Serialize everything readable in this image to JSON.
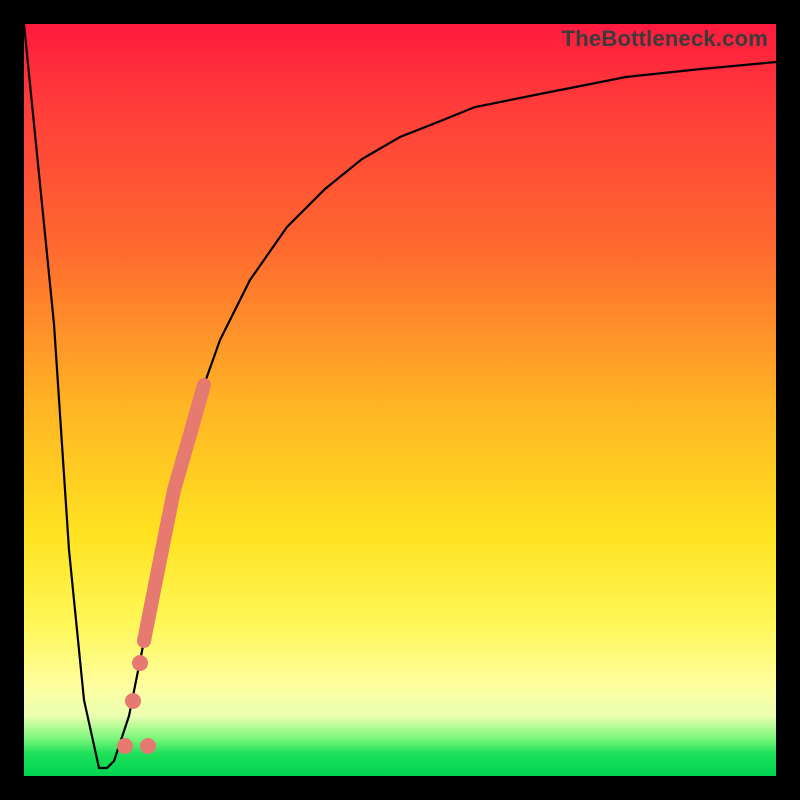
{
  "watermark": "TheBottleneck.com",
  "colors": {
    "gradient_top": "#ff1a3e",
    "gradient_mid": "#ffe321",
    "gradient_bottom": "#00d351",
    "curve": "#000000",
    "marker": "#e67a70",
    "frame": "#000000"
  },
  "chart_data": {
    "type": "line",
    "title": "",
    "xlabel": "",
    "ylabel": "",
    "xlim": [
      0,
      100
    ],
    "ylim": [
      0,
      100
    ],
    "grid": false,
    "legend": false,
    "series": [
      {
        "name": "bottleneck-curve",
        "x": [
          0,
          4,
          6,
          8,
          10,
          11,
          12,
          14,
          16,
          18,
          20,
          22,
          24,
          26,
          30,
          35,
          40,
          45,
          50,
          55,
          60,
          70,
          80,
          90,
          100
        ],
        "y": [
          100,
          60,
          30,
          10,
          1,
          1,
          2,
          8,
          18,
          28,
          38,
          45,
          52,
          58,
          66,
          73,
          78,
          82,
          85,
          87,
          89,
          91,
          93,
          94,
          95
        ]
      }
    ],
    "highlight_segment": {
      "series": "bottleneck-curve",
      "x_start": 16,
      "x_end": 24,
      "note": "thick salmon overlay on rising limb"
    },
    "markers": [
      {
        "series": "bottleneck-curve",
        "x": 14.5,
        "y": 10
      },
      {
        "series": "bottleneck-curve",
        "x": 15.5,
        "y": 15
      },
      {
        "series": "bottleneck-curve",
        "x": 16.5,
        "y": 20
      },
      {
        "series": "bottleneck-curve",
        "x": 13.5,
        "y": 4
      }
    ]
  }
}
